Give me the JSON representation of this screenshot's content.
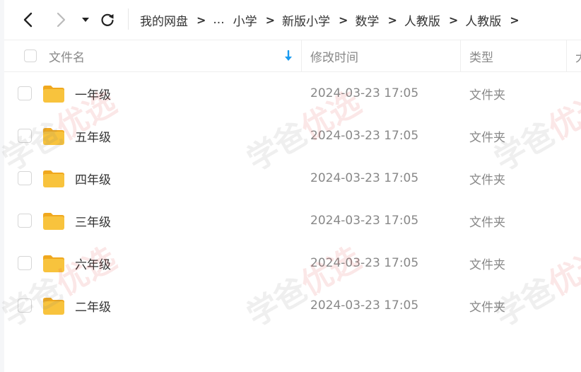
{
  "toolbar": {
    "back_icon": "chevron-left-icon",
    "forward_icon": "chevron-right-icon",
    "history_icon": "caret-down-icon",
    "refresh_icon": "refresh-icon"
  },
  "breadcrumb": {
    "items": [
      "我的网盘",
      "...",
      "小学",
      "新版小学",
      "数学",
      "人教版",
      "人教版"
    ],
    "separator": ">"
  },
  "table": {
    "columns": {
      "name": "文件名",
      "modified": "修改时间",
      "type": "类型",
      "size": "大"
    },
    "sort_icon": "arrow-down-icon",
    "rows": [
      {
        "name": "一年级",
        "modified": "2024-03-23 17:05",
        "type": "文件夹",
        "size": ""
      },
      {
        "name": "五年级",
        "modified": "2024-03-23 17:05",
        "type": "文件夹",
        "size": ""
      },
      {
        "name": "四年级",
        "modified": "2024-03-23 17:05",
        "type": "文件夹",
        "size": ""
      },
      {
        "name": "三年级",
        "modified": "2024-03-23 17:05",
        "type": "文件夹",
        "size": ""
      },
      {
        "name": "六年级",
        "modified": "2024-03-23 17:05",
        "type": "文件夹",
        "size": ""
      },
      {
        "name": "二年级",
        "modified": "2024-03-23 17:05",
        "type": "文件夹",
        "size": ""
      }
    ]
  },
  "watermark": {
    "text_gray": "学爸",
    "text_red": "优选"
  },
  "colors": {
    "accent": "#1a9bf0",
    "folder": "#f8c33d",
    "muted_text": "#888888"
  }
}
